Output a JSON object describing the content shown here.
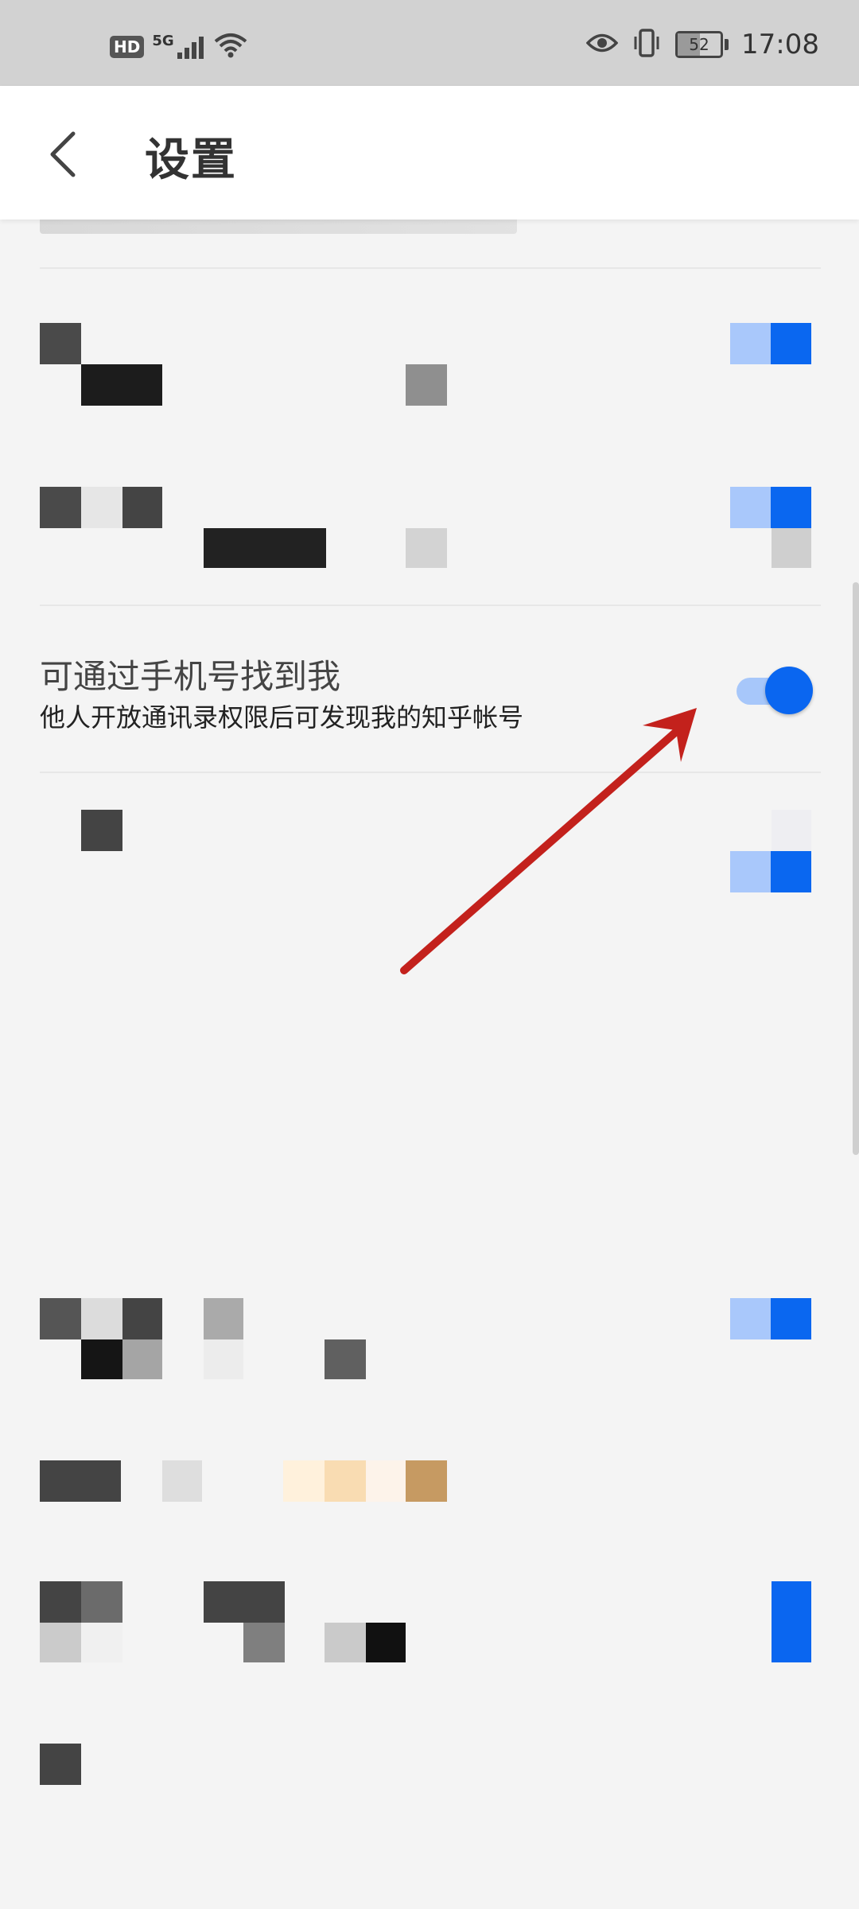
{
  "status_bar": {
    "hd": "HD",
    "network": "5G",
    "battery": "52",
    "time": "17:08"
  },
  "header": {
    "title": "设置"
  },
  "setting_find_by_phone": {
    "title": "可通过手机号找到我",
    "description": "他人开放通讯录权限后可发现我的知乎帐号",
    "enabled": true
  },
  "colors": {
    "accent": "#0a66f0",
    "accent_light": "#a7c7fa",
    "arrow": "#c3211c"
  }
}
